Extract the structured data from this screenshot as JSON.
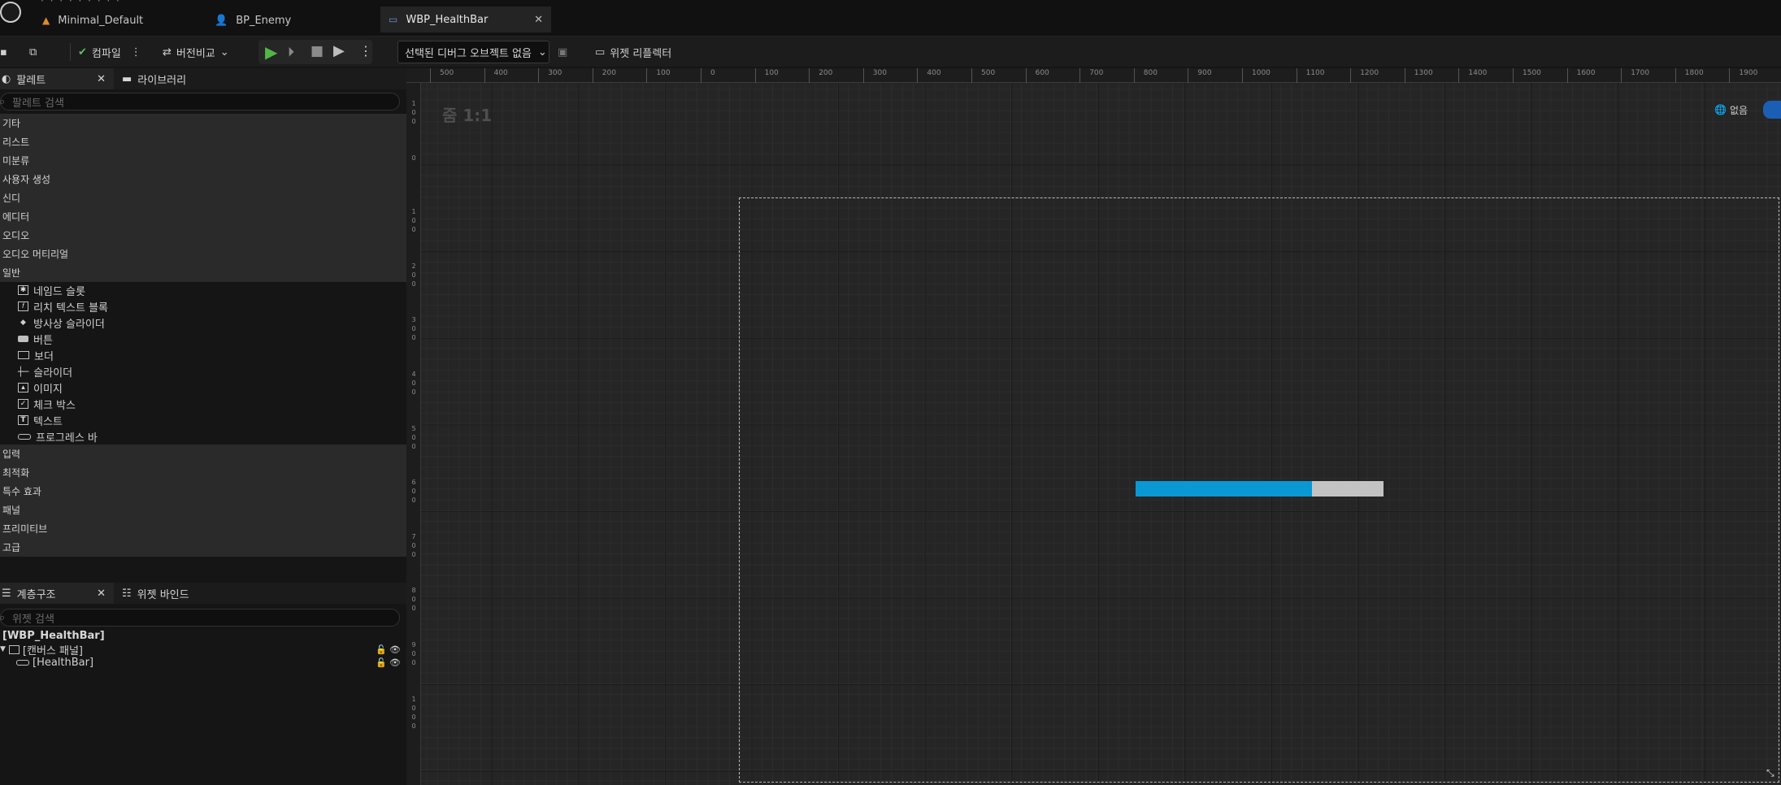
{
  "tabs": [
    {
      "label": "Minimal_Default",
      "icon": "level-icon"
    },
    {
      "label": "BP_Enemy",
      "icon": "blueprint-actor-icon"
    },
    {
      "label": "WBP_HealthBar",
      "icon": "widget-blueprint-icon",
      "active": true
    }
  ],
  "toolbar": {
    "compile": "컴파일",
    "diff": "버전비교",
    "debug_object": "선택된 디버그 오브젝트 없음",
    "reflector": "위젯 리플렉터"
  },
  "palette": {
    "tab_label": "팔레트",
    "library_label": "라이브러리",
    "search_placeholder": "팔레트 검색",
    "categories_top": [
      "기타",
      "리스트",
      "미분류",
      "사용자 생성",
      "신디",
      "에디터",
      "오디오",
      "오디오 머티리얼",
      "일반"
    ],
    "common_items": [
      {
        "label": "네임드 슬롯",
        "icon": "named-slot-icon"
      },
      {
        "label": "리치 텍스트 블록",
        "icon": "rich-text-icon"
      },
      {
        "label": "방사상 슬라이더",
        "icon": "radial-slider-icon"
      },
      {
        "label": "버튼",
        "icon": "button-icon"
      },
      {
        "label": "보더",
        "icon": "border-icon"
      },
      {
        "label": "슬라이더",
        "icon": "slider-icon"
      },
      {
        "label": "이미지",
        "icon": "image-icon"
      },
      {
        "label": "체크 박스",
        "icon": "checkbox-icon"
      },
      {
        "label": "텍스트",
        "icon": "text-icon"
      },
      {
        "label": "프로그레스 바",
        "icon": "progress-bar-icon"
      }
    ],
    "categories_bottom": [
      "입력",
      "최적화",
      "특수 효과",
      "패널",
      "프리미티브",
      "고급"
    ]
  },
  "hierarchy": {
    "tab_label": "계층구조",
    "bindings_label": "위젯 바인드",
    "search_placeholder": "위젯 검색",
    "root": "[WBP_HealthBar]",
    "nodes": [
      {
        "label": "[캔버스 패널]",
        "icon": "canvas-panel-icon"
      },
      {
        "label": "[HealthBar]",
        "icon": "progress-bar-icon"
      }
    ]
  },
  "designer": {
    "zoom": "줌 1:1",
    "dpi_label": "없음",
    "ruler_x": [
      "500",
      "400",
      "300",
      "200",
      "100",
      "0",
      "100",
      "200",
      "300",
      "400",
      "500",
      "600",
      "700",
      "800",
      "900",
      "1000",
      "1100",
      "1200",
      "1300",
      "1400",
      "1500",
      "1600",
      "1700",
      "1800",
      "1900"
    ],
    "ruler_y": [
      "100",
      "0",
      "100",
      "200",
      "300",
      "400",
      "500",
      "600",
      "700",
      "800",
      "900",
      "1000"
    ],
    "progress_percent": 0.71,
    "progress_fill_color": "#0a98d4",
    "progress_bg_color": "#c3c3c3"
  }
}
